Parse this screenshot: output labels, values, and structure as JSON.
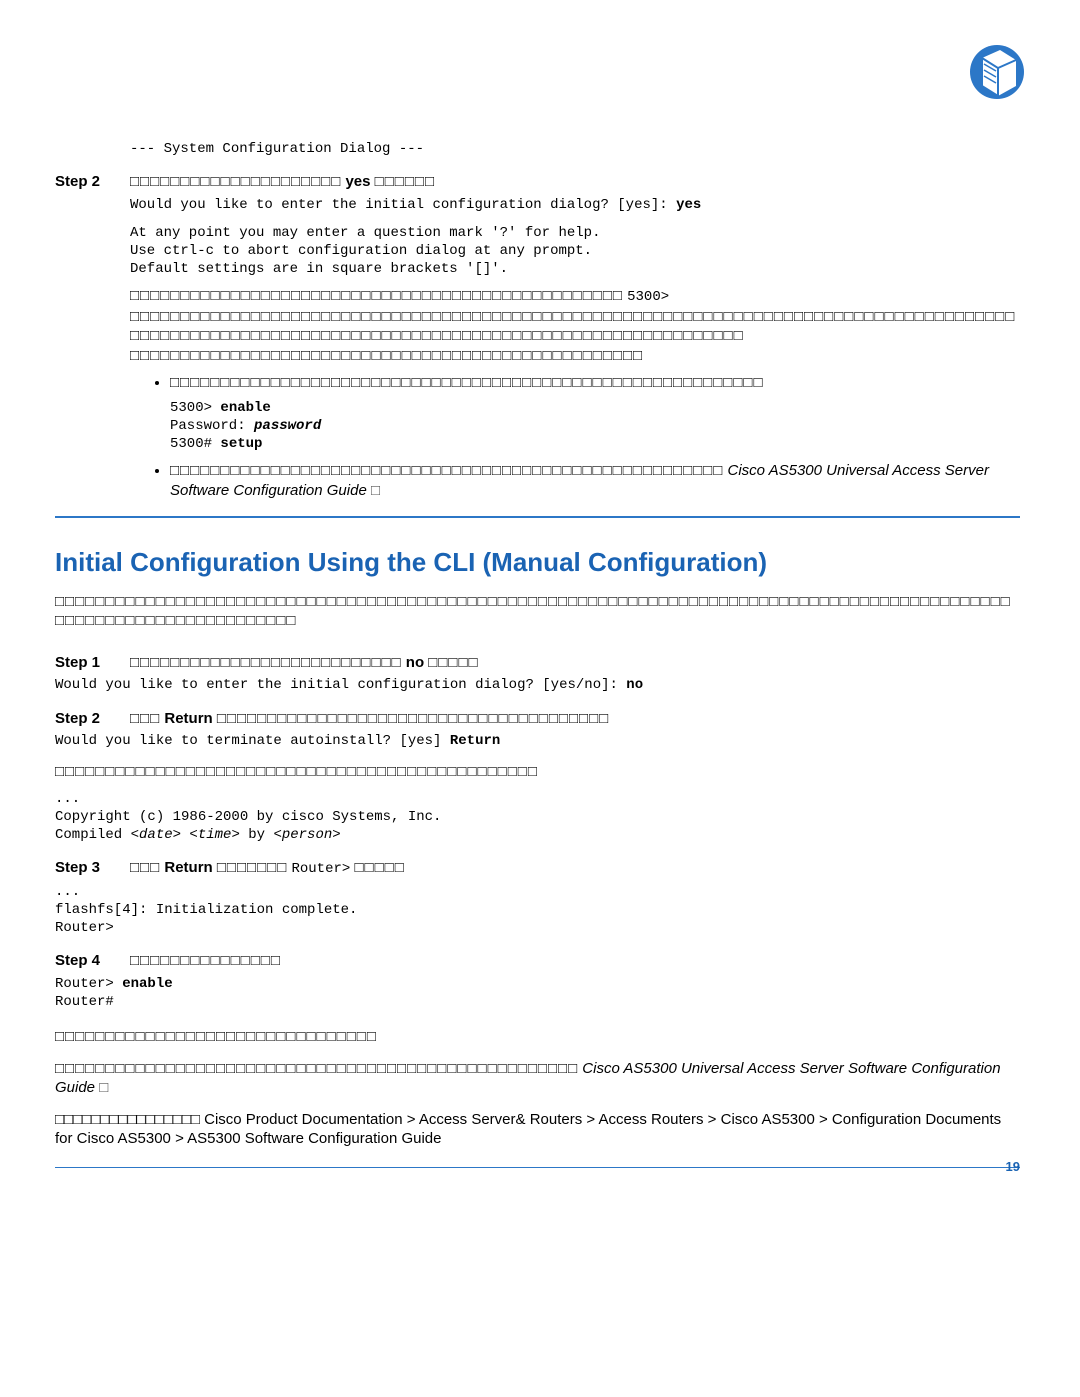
{
  "icon": {
    "name": "cisco-book-icon"
  },
  "topBlock": {
    "systemDialog": "--- System Configuration Dialog ---"
  },
  "step2a": {
    "label": "Step 2",
    "placeholder": "□□□□□□□□□□□□□□□□□□□□□",
    "yes": "yes",
    "placeholder2": "□□□□□□",
    "terminal1": "Would you like to enter the initial configuration dialog? [yes]: ",
    "terminal1Ans": "yes",
    "terminal2": "At any point you may enter a question mark '?' for help.",
    "terminal3": "Use ctrl-c to abort configuration dialog at any prompt.",
    "terminal4": "Default settings are in square brackets '[]'."
  },
  "paragraphA": {
    "pad1": "□□□□□□□□□□□□□□□□□□□□□□□□□□□□□□□□□□□□□□□□□□□□□□□□□",
    "m1": "5300>",
    "pad2": "□□□□□□□□□□□□□□□□□□□□□□□□□□□□□□□□□□□□□□□□□□□□□□□□□□□□□□□□□□□□□□□□□□□□□□□□□□□□□□□□□□□□□□□□□□□□□□□□□□□□□□□□□□□□□□□□□□□□□□□□□□□□□□□□□□□□□□□□□□□□□□□□□□□□□",
    "pad3": "□□□□□□□□□□□□□□□□□□□□□□□□□□□□□□□□□□□□□□□□□□□□□□□□□□□"
  },
  "bullets1": {
    "b1": "□□□□□□□□□□□□□□□□□□□□□□□□□□□□□□□□□□□□□□□□□□□□□□□□□□□□□□□□□□□",
    "code1": "5300> ",
    "code1b": "enable",
    "code2": "Password: ",
    "code2b": "password",
    "code3": "5300# ",
    "code3b": "setup",
    "b2a": "□□□□□□□□□□□□□□□□□□□□□□□□□□□□□□□□□□□□□□□□□□□□□□□□□□□□□□□",
    "b2ref": "Cisco AS5300 Universal Access Server Software Configuration Guide",
    "b2end": "□"
  },
  "sectionTitle": "Initial Configuration Using the CLI (Manual Configuration)",
  "sectionLead": "□□□□□□□□□□□□□□□□□□□□□□□□□□□□□□□□□□□□□□□□□□□□□□□□□□□□□□□□□□□□□□□□□□□□□□□□□□□□□□□□□□□□□□□□□□□□□□□□□□□□□□□□□□□□□□□□□□□□□□□",
  "step1": {
    "label": "Step 1",
    "padA": "□□□□□□□□□□□□□□□□□□□□□□□□□□□",
    "no": "no",
    "padB": "□□□□□",
    "terminal": "Would you like to enter the initial configuration dialog? [yes/no]: ",
    "terminalAns": "no"
  },
  "step2b": {
    "label": "Step 2",
    "padA": "□□□",
    "ret": "Return",
    "padB": "□□□□□□□□□□□□□□□□□□□□□□□□□□□□□□□□□□□□□□□",
    "terminal": "Would you like to terminate autoinstall? [yes] ",
    "terminalAns": "Return"
  },
  "midPara": "□□□□□□□□□□□□□□□□□□□□□□□□□□□□□□□□□□□□□□□□□□□□□□□□",
  "code2c": {
    "dots": "...",
    "l1": "Copyright (c) 1986-2000 by cisco Systems, Inc.",
    "l2": "Compiled <date> <time> by <person>"
  },
  "step3": {
    "label": "Step 3",
    "padA": "□□□",
    "ret": "Return",
    "padB": "□□□□□□□",
    "routerMono": "Router>",
    "padC": "□□□□□",
    "c0": "...",
    "c1": "flashfs[4]: Initialization complete.",
    "c2": "Router>"
  },
  "step4": {
    "label": "Step 4",
    "pad": "□□□□□□□□□□□□□□□",
    "c1": "Router> ",
    "c1b": "enable",
    "c2": "Router#"
  },
  "footer": {
    "p1": "□□□□□□□□□□□□□□□□□□□□□□□□□□□□□□□□",
    "p2a": "□□□□□□□□□□□□□□□□□□□□□□□□□□□□□□□□□□□□□□□□□□□□□□□□□□□□",
    "p2ref": "Cisco AS5300 Universal Access Server Software Configuration Guide",
    "p2b": "□",
    "p3a": "□□□□□□□□□□□□□□□□ Cisco Product Documentation > Access Server& Routers > Access Routers > Cisco AS5300 > Configuration Documents for Cisco AS5300 > AS5300 Software Configuration Guide"
  },
  "pageNumber": "19"
}
